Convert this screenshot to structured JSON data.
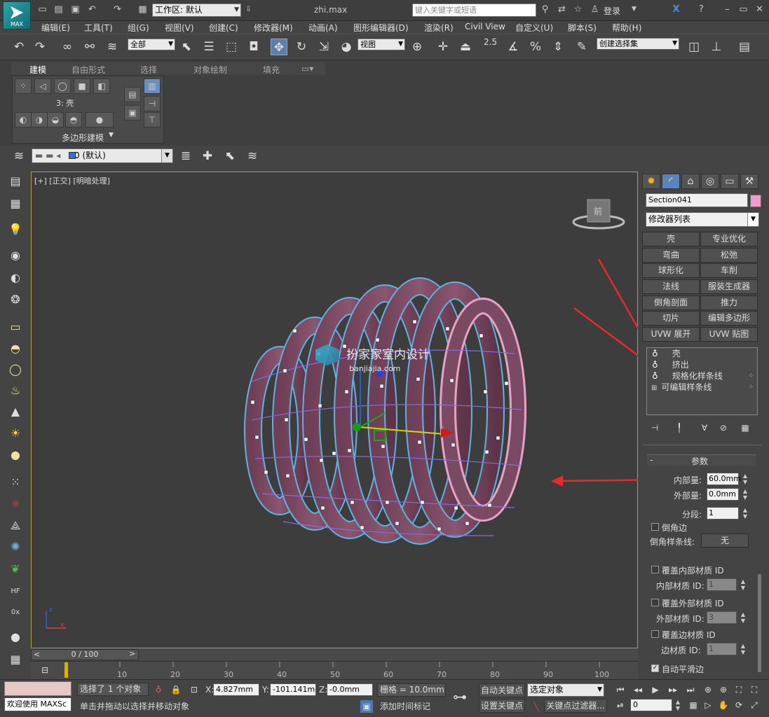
{
  "title": {
    "workspace": "工作区: 默认",
    "document": "zhi.max",
    "search_placeholder": "键入关键字或短语",
    "login": "登录",
    "app_badge": "MAX"
  },
  "menu": [
    "编辑(E)",
    "工具(T)",
    "组(G)",
    "视图(V)",
    "创建(C)",
    "修改器(M)",
    "动画(A)",
    "图形编辑器(D)",
    "渲染(R)",
    "Civil View",
    "自定义(U)",
    "脚本(S)",
    "帮助(H)"
  ],
  "toolbar": {
    "filter": "全部",
    "view_coord": "视图",
    "snap_value": "2.5",
    "selection_set": "创建选择集"
  },
  "ribbon": {
    "tabs": [
      "建模",
      "自由形式",
      "选择",
      "对象绘制",
      "填充"
    ],
    "level_label": "3: 壳",
    "panel_label": "多边形建模"
  },
  "layer": {
    "current": "0 (默认)"
  },
  "viewport": {
    "label": "[+] [正交] [明暗处理]",
    "viewcube_face": "前"
  },
  "watermark": {
    "title": "扮家家室内设计",
    "url": "banjiajia.com"
  },
  "command_panel": {
    "object_name": "Section041",
    "object_color": "#f09cc8",
    "modifier_list": "修改器列表",
    "modifier_buttons": [
      [
        "壳",
        "专业优化"
      ],
      [
        "弯曲",
        "松弛"
      ],
      [
        "球形化",
        "车削"
      ],
      [
        "法线",
        "服装生成器"
      ],
      [
        "倒角剖面",
        "推力"
      ],
      [
        "切片",
        "编辑多边形"
      ],
      [
        "UVW 展开",
        "UVW 贴图"
      ]
    ],
    "stack": [
      {
        "label": "壳",
        "selected": false,
        "bulb": true
      },
      {
        "label": "挤出",
        "selected": false,
        "bulb": true
      },
      {
        "label": "规格化样条线",
        "selected": false,
        "bulb": true
      },
      {
        "label": "可编辑样条线",
        "selected": false,
        "bulb": false
      }
    ],
    "rollout_title": "参数",
    "params": {
      "inner_amount_label": "内部量:",
      "inner_amount": "60.0mm",
      "outer_amount_label": "外部量:",
      "outer_amount": "0.0mm",
      "segments_label": "分段:",
      "segments": "1",
      "bevel_edges": "倒角边",
      "bevel_spline_label": "倒角样条线:",
      "bevel_spline": "无",
      "override_inner": "覆盖内部材质 ID",
      "inner_id_label": "内部材质 ID:",
      "inner_id": "1",
      "override_outer": "覆盖外部材质 ID",
      "outer_id_label": "外部材质 ID:",
      "outer_id": "3",
      "override_edge": "覆盖边材质 ID",
      "edge_id_label": "边材质 ID:",
      "edge_id": "1",
      "auto_smooth": "自动平滑边"
    }
  },
  "timeline": {
    "frame": "0 / 100",
    "ticks": [
      "10",
      "20",
      "30",
      "40",
      "50",
      "60",
      "70",
      "80",
      "90",
      "100"
    ]
  },
  "status": {
    "welcome": "欢迎使用 MAXSc",
    "selected": "选择了 1 个对象",
    "prompt": "单击并拖动以选择并移动对象",
    "x": "4.827mm",
    "y": "-101.141m",
    "z": "-0.0mm",
    "grid": "栅格 = 10.0mm",
    "add_time_tag": "添加时间标记",
    "auto_key": "自动关键点",
    "set_key": "设置关键点",
    "selected_obj": "选定对象",
    "key_filters": "关键点过滤器...",
    "frame_field": "0"
  }
}
